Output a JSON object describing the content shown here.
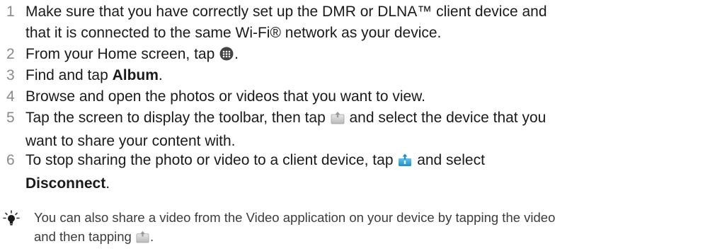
{
  "steps": [
    {
      "num": "1",
      "text": "Make sure that you have correctly set up the DMR or DLNA™ client device and",
      "text2": "that it is connected to the same Wi-Fi® network as your device."
    },
    {
      "num": "2",
      "pre": "From your Home screen, tap",
      "post": ".",
      "icon": "apps-grid-icon"
    },
    {
      "num": "3",
      "pre": "Find and tap ",
      "bold": "Album",
      "post": "."
    },
    {
      "num": "4",
      "text": "Browse and open the photos or videos that you want to view."
    },
    {
      "num": "5",
      "pre": "Tap the screen to display the toolbar, then tap",
      "post": "and select the device that you",
      "line2": "want to share your content with.",
      "icon": "throw-icon"
    },
    {
      "num": "6",
      "pre": "To stop sharing the photo or video to a client device, tap",
      "post": "and select",
      "bold2": "Disconnect",
      "post2": ".",
      "icon": "throw-active-icon"
    }
  ],
  "tip": {
    "icon": "lightbulb-tip-icon",
    "line1": "You can also share a video from the Video application on your device by tapping the video",
    "line2_pre": "and then tapping",
    "line2_post": ".",
    "inline_icon": "throw-icon"
  }
}
